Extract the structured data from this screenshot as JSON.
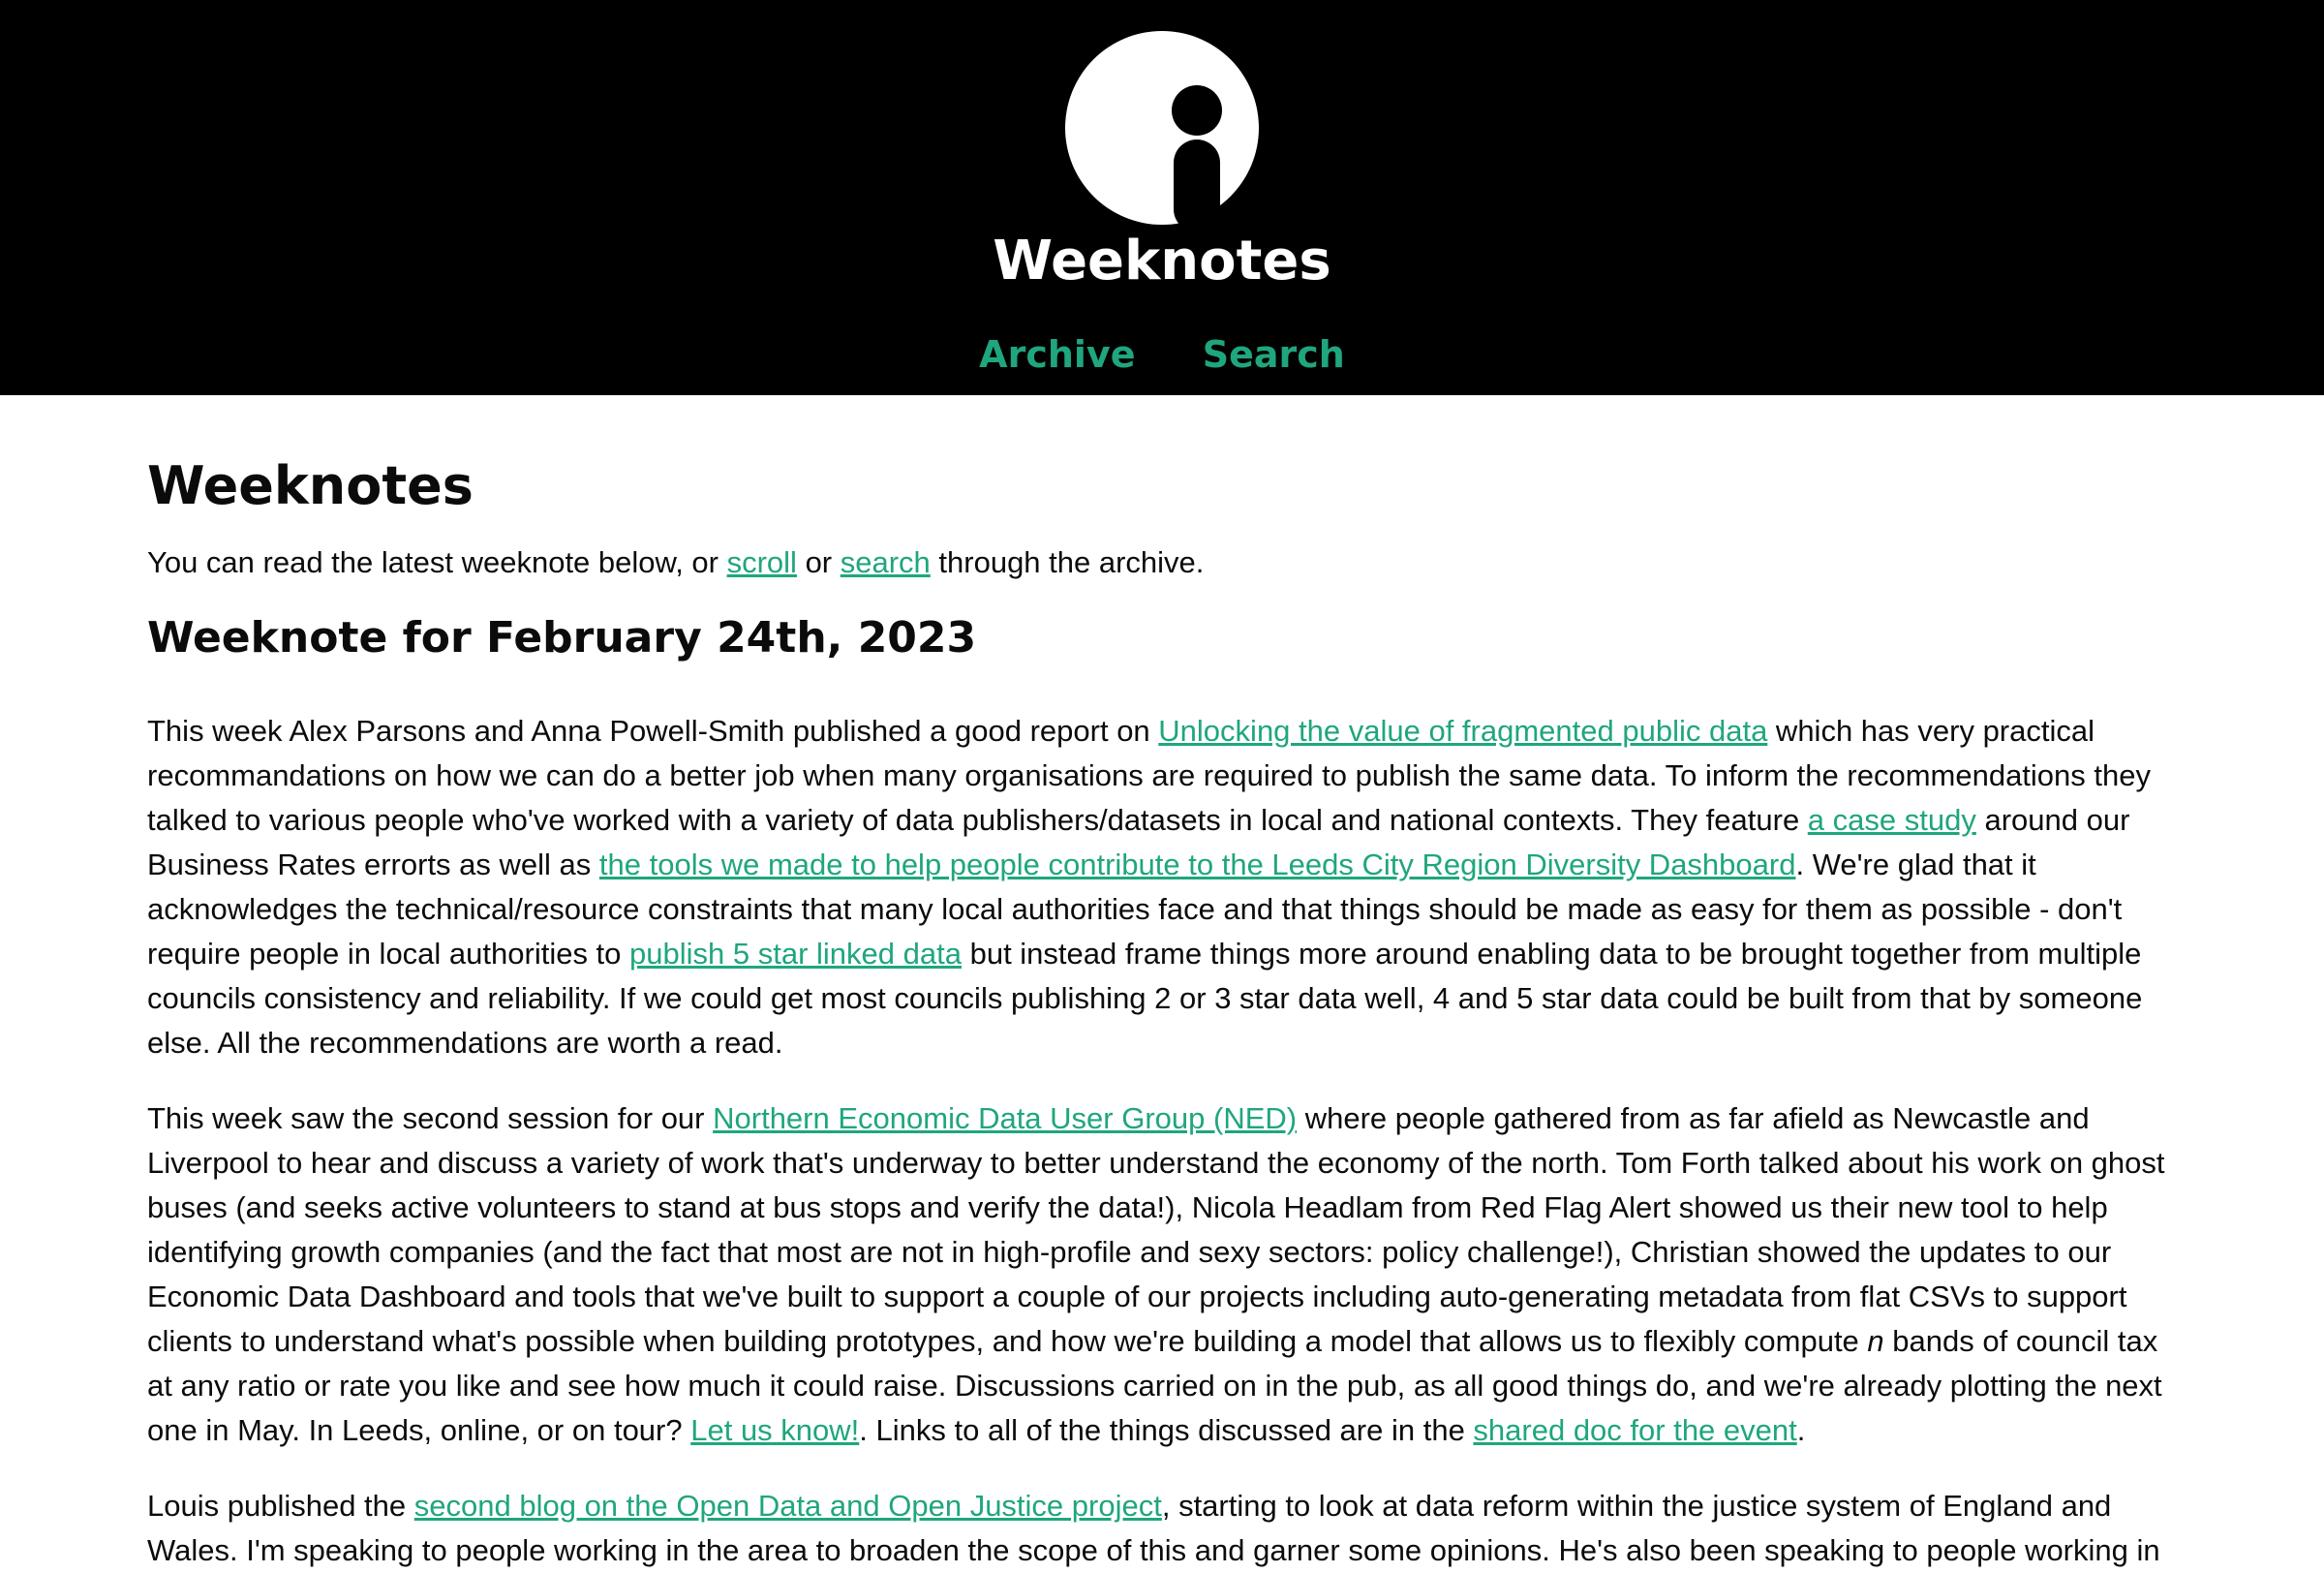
{
  "header": {
    "logo_icon": "info-i-logo",
    "site_title": "Weeknotes",
    "nav": [
      {
        "label": "Archive"
      },
      {
        "label": "Search"
      }
    ]
  },
  "colors": {
    "header_bg": "#000000",
    "accent": "#1fa67e",
    "text": "#0b0b0b"
  },
  "main": {
    "page_title": "Weeknotes",
    "intro": {
      "before": "You can read the latest weeknote below, or ",
      "link1": "scroll",
      "middle": " or ",
      "link2": "search",
      "after": " through the archive."
    },
    "note_title": "Weeknote for February 24th, 2023",
    "p1": {
      "t1": "This week Alex Parsons and Anna Powell-Smith published a good report on ",
      "l1": "Unlocking the value of fragmented public data",
      "t2": " which has very practical recommandations on how we can do a better job when many organisations are required to publish the same data. To inform the recommendations they talked to various people who've worked with a variety of data publishers/datasets in local and national contexts. They feature ",
      "l2": "a case study",
      "t3": " around our Business Rates errorts as well as ",
      "l3": "the tools we made to help people contribute to the Leeds City Region Diversity Dashboard",
      "t4": ". We're glad that it acknowledges the technical/resource constraints that many local authorities face and that things should be made as easy for them as possible - don't require people in local authorities to ",
      "l4": "publish 5 star linked data",
      "t5": " but instead frame things more around enabling data to be brought together from multiple councils consistency and reliability. If we could get most councils publishing 2 or 3 star data well, 4 and 5 star data could be built from that by someone else. All the recommendations are worth a read."
    },
    "p2": {
      "t1": "This week saw the second session for our ",
      "l1": "Northern Economic Data User Group (NED)",
      "t2": " where people gathered from as far afield as Newcastle and Liverpool to hear and discuss a variety of work that's underway to better understand the economy of the north. Tom Forth talked about his work on ghost buses (and seeks active volunteers to stand at bus stops and verify the data!), Nicola Headlam from Red Flag Alert showed us their new tool to help identifying growth companies (and the fact that most are not in high-profile and sexy sectors: policy challenge!), Christian showed the updates to our Economic Data Dashboard and tools that we've built to support a couple of our projects including auto-generating metadata from flat CSVs to support clients to understand what's possible when building prototypes, and how we're building a model that allows us to flexibly compute ",
      "em": "n",
      "t3": " bands of council tax at any ratio or rate you like and see how much it could raise. Discussions carried on in the pub, as all good things do, and we're already plotting the next one in May. In Leeds, online, or on tour? ",
      "l2": "Let us know!",
      "t4": ". Links to all of the things discussed are in the ",
      "l3": "shared doc for the event",
      "t5": "."
    },
    "p3": {
      "t1": "Louis published the ",
      "l1": "second blog on the Open Data and Open Justice project",
      "t2": ", starting to look at data reform within the justice system of England and Wales. I'm speaking to people working in the area to broaden the scope of this and garner some opinions. He's also been speaking to people working in"
    }
  }
}
